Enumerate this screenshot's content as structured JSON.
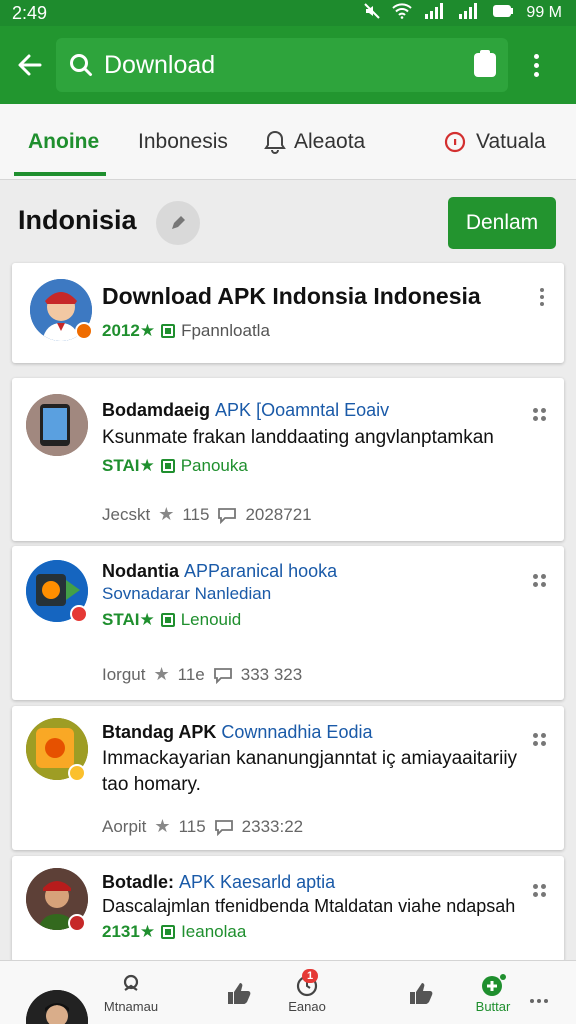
{
  "status_bar": {
    "time": "2:49",
    "battery": "99 M"
  },
  "search": {
    "query": "Download"
  },
  "tabs": [
    {
      "label": "Anoine"
    },
    {
      "label": "Inbonesis"
    },
    {
      "label": "Aleaota"
    },
    {
      "label": "Vatuala"
    }
  ],
  "section": {
    "title": "Indonisia",
    "button_label": "Denlam"
  },
  "cards": [
    {
      "title": "Download APK Indonsia Indonesia",
      "rating": "2012★",
      "store": "Fpannloatla"
    },
    {
      "title": "Bodamdaeig",
      "title_sub": "APK [Ooamntal Eoaiv",
      "desc": "Ksunmate frakan landdaating angvlanptamkan",
      "rating": "STAI★",
      "store": "Panouka",
      "meta_label": "Jecskt",
      "meta_rating": "115",
      "meta_date": "2028721"
    },
    {
      "title": "Nodantia",
      "title_sub": "APParanical hooka",
      "subtitle2": "Sovnadarar Nanledian",
      "rating": "STAI★",
      "store": "Lenouid",
      "meta_label": "Iorgut",
      "meta_rating": "11e",
      "meta_date": "333 323"
    },
    {
      "title": "Btandag APK",
      "title_sub": "Cownnadhia Eodia",
      "desc": "Immackayarian kananungjanntat iç amiayaaitariiy tao homary.",
      "meta_label": "Aorpit",
      "meta_rating": "115",
      "meta_date": "2333:22"
    },
    {
      "title": "Botadle:",
      "title_sub": "APK Kaesarld aptia",
      "desc": "Dascalajmlan tfenidbenda Mtaldatan viahe ndapsah",
      "rating": "2131★",
      "store": "Ieanolaa"
    }
  ],
  "bottom_nav": {
    "items": [
      {
        "label": "Mtnamau"
      },
      {
        "label": ""
      },
      {
        "label": "Eanao",
        "badge": "1"
      },
      {
        "label": ""
      },
      {
        "label": "Buttar"
      }
    ]
  },
  "colors": {
    "brand_green": "#22962f",
    "link_blue": "#1a5aa8",
    "badge_red": "#e53935"
  }
}
